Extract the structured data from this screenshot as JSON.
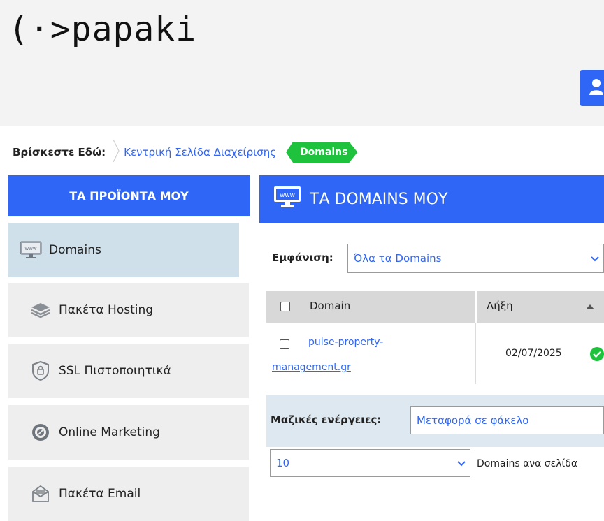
{
  "header": {
    "logo_text": "(·>papaki"
  },
  "breadcrumb": {
    "here_label": "Βρίσκεστε Εδώ:",
    "items": [
      "Κεντρική Σελίδα Διαχείρισης",
      "Domains"
    ]
  },
  "sidebar": {
    "title": "ΤΑ ΠΡΟΪΟΝΤΑ ΜΟΥ",
    "items": [
      {
        "label": "Domains",
        "icon": "www-icon"
      },
      {
        "label": "Πακέτα Hosting",
        "icon": "layers-icon"
      },
      {
        "label": "SSL Πιστοποιητικά",
        "icon": "shield-lock-icon"
      },
      {
        "label": "Online Marketing",
        "icon": "target-icon"
      },
      {
        "label": "Πακέτα Email",
        "icon": "envelope-icon"
      }
    ]
  },
  "main": {
    "title": "ΤΑ DOMAINS ΜΟΥ",
    "filter_label": "Εμφάνιση:",
    "filter_value": "Όλα τα Domains",
    "table": {
      "columns": [
        "Domain",
        "Λήξη"
      ],
      "rows": [
        {
          "domain_line1": "pulse-property-",
          "domain_line2": "management.gr",
          "expiry": "02/07/2025"
        }
      ]
    },
    "bulk_label": "Μαζικές ενέργειες:",
    "bulk_value": "Μεταφορά σε φάκελο",
    "page_size_value": "10",
    "page_size_label": "Domains ανα σελίδα"
  },
  "colors": {
    "primary": "#2f66f5",
    "success": "#1ec23c",
    "sidebar_active": "#cfe0ea"
  }
}
